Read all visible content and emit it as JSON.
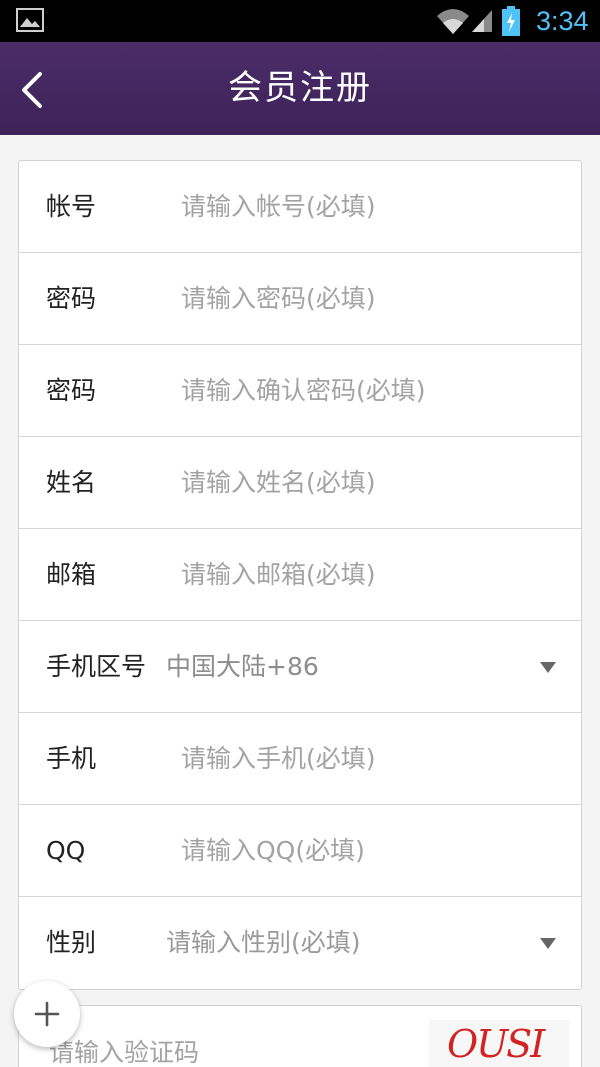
{
  "status_bar": {
    "time": "3:34"
  },
  "header": {
    "title": "会员注册"
  },
  "form": {
    "account": {
      "label": "帐号",
      "placeholder": "请输入帐号(必填)"
    },
    "password": {
      "label": "密码",
      "placeholder": "请输入密码(必填)"
    },
    "confirm_password": {
      "label": "密码",
      "placeholder": "请输入确认密码(必填)"
    },
    "name": {
      "label": "姓名",
      "placeholder": "请输入姓名(必填)"
    },
    "email": {
      "label": "邮箱",
      "placeholder": "请输入邮箱(必填)"
    },
    "area_code": {
      "label": "手机区号",
      "value": "中国大陆+86"
    },
    "phone": {
      "label": "手机",
      "placeholder": "请输入手机(必填)"
    },
    "qq": {
      "label": "QQ",
      "placeholder": "请输入QQ(必填)"
    },
    "gender": {
      "label": "性别",
      "value": "请输入性别(必填)"
    }
  },
  "captcha": {
    "placeholder": "请输入验证码",
    "image_text": "OUSI"
  },
  "colors": {
    "header": "#45285f",
    "clock": "#4fc3f7",
    "captcha": "#d32222"
  }
}
